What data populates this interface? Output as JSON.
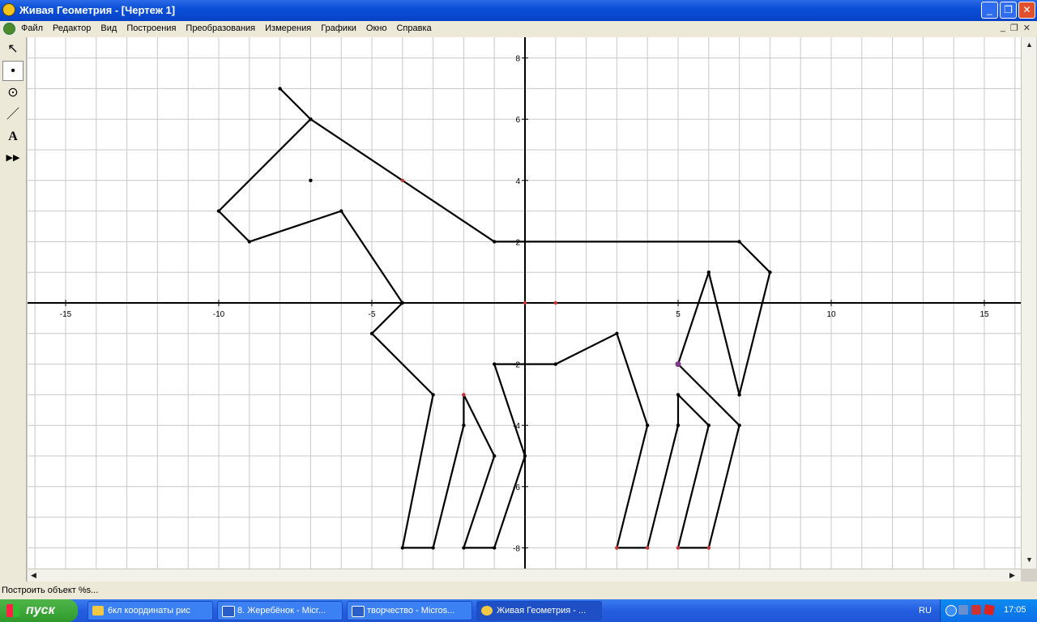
{
  "window": {
    "title": "Живая Геометрия - [Чертеж 1]"
  },
  "menu": [
    "Файл",
    "Редактор",
    "Вид",
    "Построения",
    "Преобразования",
    "Измерения",
    "Графики",
    "Окно",
    "Справка"
  ],
  "tools": [
    {
      "name": "arrow-tool-icon",
      "glyph": "↖"
    },
    {
      "name": "point-tool-icon",
      "glyph": "•"
    },
    {
      "name": "compass-tool-icon",
      "glyph": "⊙"
    },
    {
      "name": "line-tool-icon",
      "glyph": "／"
    },
    {
      "name": "text-tool-icon",
      "glyph": "A"
    },
    {
      "name": "custom-tool-icon",
      "glyph": "▶▶"
    }
  ],
  "graph": {
    "x_ticks": [
      -15,
      -10,
      -5,
      5,
      10,
      15
    ],
    "y_ticks": [
      8,
      6,
      4,
      2,
      -2,
      -4,
      -6,
      -8
    ],
    "polylines": [
      [
        [
          -8,
          7
        ],
        [
          -7,
          6
        ],
        [
          -10,
          3
        ],
        [
          -9,
          2
        ],
        [
          -6,
          3
        ],
        [
          -4,
          0
        ],
        [
          -5,
          -1
        ],
        [
          -3,
          -3
        ],
        [
          -4,
          -8
        ],
        [
          -3,
          -8
        ],
        [
          -2,
          -4
        ],
        [
          -2,
          -3
        ],
        [
          -1,
          -5
        ],
        [
          -2,
          -8
        ],
        [
          -1,
          -8
        ],
        [
          0,
          -5
        ],
        [
          -1,
          -2
        ],
        [
          1,
          -2
        ],
        [
          3,
          -1
        ],
        [
          4,
          -4
        ],
        [
          3,
          -8
        ],
        [
          4,
          -8
        ],
        [
          5,
          -4
        ],
        [
          5,
          -3
        ],
        [
          6,
          -4
        ],
        [
          5,
          -8
        ],
        [
          6,
          -8
        ],
        [
          7,
          -4
        ],
        [
          5,
          -2
        ],
        [
          6,
          1
        ],
        [
          7,
          -3
        ],
        [
          8,
          1
        ],
        [
          7,
          2
        ],
        [
          -1,
          2
        ],
        [
          -7,
          6
        ]
      ]
    ],
    "points": [
      {
        "x": -7,
        "y": 4,
        "color": "#000000"
      },
      {
        "x": -4,
        "y": 4,
        "color": "#cc3333"
      },
      {
        "x": 0,
        "y": 0,
        "color": "#cc3333"
      },
      {
        "x": 1,
        "y": 0,
        "color": "#cc3333"
      },
      {
        "x": 5,
        "y": -2,
        "color": "#7a3b8c"
      },
      {
        "x": -2,
        "y": -3,
        "color": "#cc3333"
      },
      {
        "x": 3,
        "y": -8,
        "color": "#cc3333"
      },
      {
        "x": 4,
        "y": -8,
        "color": "#cc3333"
      },
      {
        "x": 5,
        "y": -8,
        "color": "#cc3333"
      },
      {
        "x": 6,
        "y": -8,
        "color": "#cc3333"
      }
    ]
  },
  "status": "Построить объект %s...",
  "taskbar": {
    "start": "пуск",
    "tasks": [
      "6кл координаты рис",
      "8. Жеребёнок - Micr...",
      "творчество - Micros...",
      "Живая Геометрия - ..."
    ],
    "lang": "RU",
    "clock": "17:05"
  }
}
